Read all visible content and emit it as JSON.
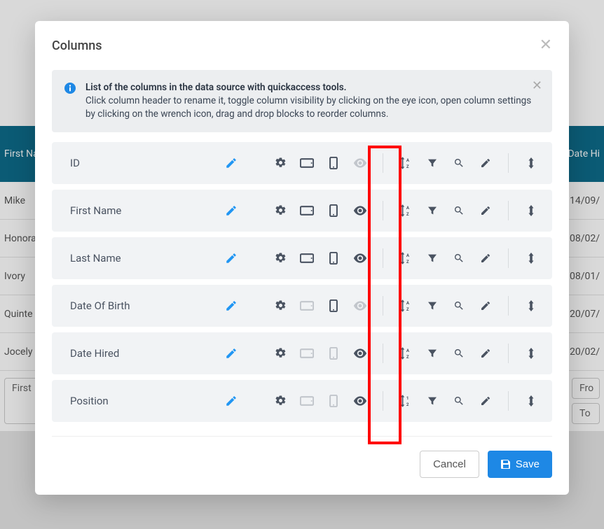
{
  "modal": {
    "title": "Columns",
    "info_title": "List of the columns in the data source with quickaccess tools.",
    "info_body": "Click column header to rename it, toggle column visibility by clicking on the eye icon, open column settings by clicking on the wrench icon, drag and drop blocks to reorder columns.",
    "columns": [
      {
        "label": "ID",
        "eye_muted": true,
        "tablet_muted": false,
        "phone_muted": false,
        "sort_variant": "az"
      },
      {
        "label": "First Name",
        "eye_muted": false,
        "tablet_muted": false,
        "phone_muted": false,
        "sort_variant": "az"
      },
      {
        "label": "Last Name",
        "eye_muted": false,
        "tablet_muted": false,
        "phone_muted": false,
        "sort_variant": "az"
      },
      {
        "label": "Date Of Birth",
        "eye_muted": true,
        "tablet_muted": true,
        "phone_muted": false,
        "sort_variant": "az"
      },
      {
        "label": "Date Hired",
        "eye_muted": false,
        "tablet_muted": true,
        "phone_muted": true,
        "sort_variant": "az"
      },
      {
        "label": "Position",
        "eye_muted": false,
        "tablet_muted": true,
        "phone_muted": true,
        "sort_variant": "12"
      }
    ],
    "cancel_label": "Cancel",
    "save_label": "Save"
  },
  "background": {
    "header_left": "First Na",
    "header_right": "Date Hi",
    "rows": [
      {
        "name": "Mike",
        "date": "14/09/"
      },
      {
        "name": "Honora",
        "date": "08/02/"
      },
      {
        "name": "Ivory",
        "date": "08/01/"
      },
      {
        "name": "Quinte",
        "date": "20/07/"
      },
      {
        "name": "Jocely",
        "date": "20/02/"
      }
    ],
    "filter_left": "First",
    "filter_from": "Fro",
    "filter_to": "To"
  }
}
